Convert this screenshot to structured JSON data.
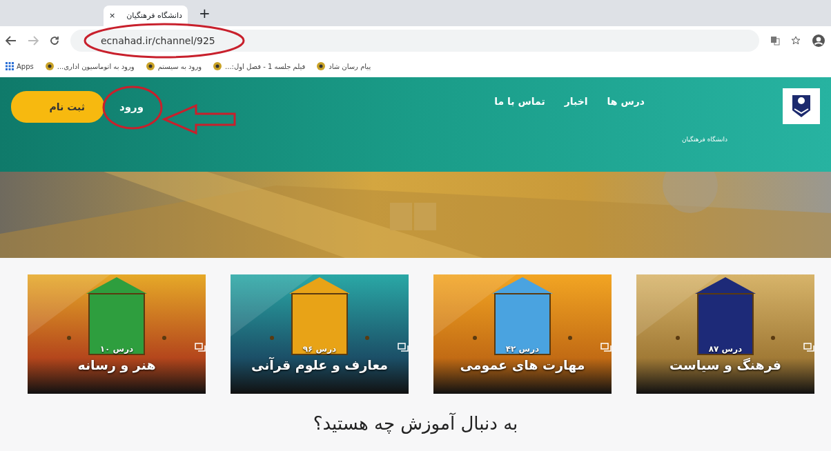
{
  "browser": {
    "tab": {
      "title": "دانشگاه فرهنگیان",
      "close": "×"
    },
    "new_tab": "+",
    "address": "ecnahad.ir/channel/925",
    "apps": "Apps",
    "bookmarks": [
      {
        "kind": "site",
        "label": "پیام رسان شاد"
      },
      {
        "kind": "site",
        "label": "فیلم جلسه 1 - فصل اول:..."
      },
      {
        "kind": "site",
        "label": "ورود به سیستم"
      },
      {
        "kind": "site",
        "label": "ورود به اتوماسیون اداری..."
      }
    ]
  },
  "site": {
    "logo_caption": "دانشگاه فرهنگیان",
    "nav": [
      "درس ها",
      "اخبار",
      "تماس با ما"
    ],
    "login": "ورود",
    "register": "ثبت نام",
    "categories": [
      {
        "title": "فرهنگ و سیاست",
        "lessons": "درس ۸۷",
        "color": "#1d2a78"
      },
      {
        "title": "مهارت های عمومی",
        "lessons": "درس ۴۲",
        "color": "#4aa3e0"
      },
      {
        "title": "معارف و علوم قرآنی",
        "lessons": "درس ۹۶",
        "color": "#e8a317"
      },
      {
        "title": "هنر و رسانه",
        "lessons": "درس ۱۰",
        "color": "#2e9e3e"
      }
    ],
    "heading": "به دنبال آموزش چه هستید؟"
  }
}
